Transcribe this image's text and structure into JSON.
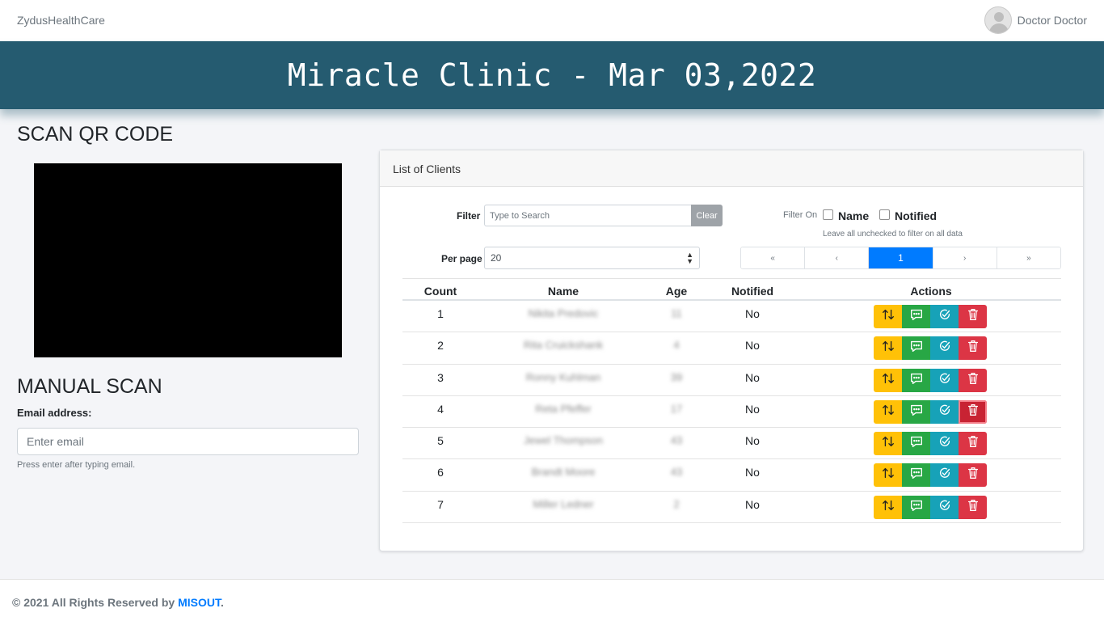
{
  "nav": {
    "brand": "ZydusHealthCare",
    "user_name": "Doctor Doctor"
  },
  "banner": {
    "title": "Miracle Clinic - Mar 03,2022"
  },
  "left": {
    "qr_title": "SCAN QR CODE",
    "manual_title": "MANUAL SCAN",
    "email_label": "Email address:",
    "email_placeholder": "Enter email",
    "email_help": "Press enter after typing email."
  },
  "clients": {
    "header": "List of Clients",
    "filter_label": "Filter",
    "filter_placeholder": "Type to Search",
    "clear_label": "Clear",
    "filter_on_label": "Filter On",
    "filter_options": [
      "Name",
      "Notified"
    ],
    "filter_hint": "Leave all unchecked to filter on all data",
    "per_page_label": "Per page",
    "per_page_value": "20",
    "pagination": [
      "«",
      "‹",
      "1",
      "›",
      "»"
    ],
    "active_page": "1",
    "columns": [
      "Count",
      "Name",
      "Age",
      "Notified",
      "Actions"
    ],
    "rows": [
      {
        "count": "1",
        "name": "Nikita Predovic",
        "age": "11",
        "notified": "No"
      },
      {
        "count": "2",
        "name": "Rita Cruickshank",
        "age": "4",
        "notified": "No"
      },
      {
        "count": "3",
        "name": "Ronny Kuhlman",
        "age": "39",
        "notified": "No"
      },
      {
        "count": "4",
        "name": "Reta Pfeffer",
        "age": "17",
        "notified": "No"
      },
      {
        "count": "5",
        "name": "Jewel Thompson",
        "age": "43",
        "notified": "No"
      },
      {
        "count": "6",
        "name": "Brandt Moore",
        "age": "43",
        "notified": "No"
      },
      {
        "count": "7",
        "name": "Miller Ledner",
        "age": "2",
        "notified": "No"
      }
    ],
    "action_icons": [
      "swap-vertical-icon",
      "message-icon",
      "check-circle-icon",
      "trash-icon"
    ],
    "colors": {
      "move": "#ffc107",
      "message": "#28a745",
      "check": "#17a2b8",
      "delete": "#dc3545"
    }
  },
  "footer": {
    "text": "© 2021 All Rights Reserved by",
    "link": "MISOUT",
    "suffix": "."
  }
}
